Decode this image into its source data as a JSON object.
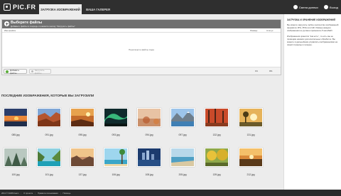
{
  "header": {
    "logo_text": "PIC.FR",
    "tabs": [
      {
        "label": "ЗАГРУЗКА ИЗОБРАЖЕНИЙ",
        "active": true
      },
      {
        "label": "ВАША ГАЛЕРЕЯ",
        "active": false
      }
    ],
    "right_links": [
      {
        "label": "Смена данных",
        "icon": "settings-icon"
      },
      {
        "label": "Выход",
        "icon": "logout-icon"
      }
    ]
  },
  "uploader": {
    "title": "Выберите файлы",
    "subtitle": "Добавьте файлы в очередь и нажмите кнопку \"Загрузить файлы\"",
    "columns": {
      "name": "Имя файла",
      "size": "Размер",
      "status": "Статус"
    },
    "drop_hint": "Перетащите файлы сюда",
    "add_button": "Добавить файлы",
    "start_button": "Загрузить файлы",
    "total_size": "0 b",
    "total_percent": "0%"
  },
  "sidebar": {
    "title": "ЗАГРУЗКА И ХРАНЕНИЕ ИЗОБРАЖЕНИЙ",
    "paragraphs": [
      "Вы можете загрузить любое количество изображений форматов JPG, PNG или GIF. Размер каждого изображения не должен превышать 5 мегабайт.",
      "Изображения хранятся \"как есть\", то есть мы не проводим никаких дополнительных обработок. Вы можете в дальнейшем управлять изображениями на своей странице в галерее."
    ]
  },
  "gallery": {
    "section_title": "ПОСЛЕДНИЕ ИЗОБРАЖЕНИЯ, КОТОРЫЕ ВЫ ЗАГРУЗИЛИ",
    "images": [
      {
        "caption": "085.jpg",
        "scene": "sunset-sea"
      },
      {
        "caption": "091.jpg",
        "scene": "canyon"
      },
      {
        "caption": "095.jpg",
        "scene": "desert-sunset"
      },
      {
        "caption": "093.jpg",
        "scene": "aurora"
      },
      {
        "caption": "094.jpg",
        "scene": "autumn-haze"
      },
      {
        "caption": "097.jpg",
        "scene": "lake-mountains"
      },
      {
        "caption": "132.jpg",
        "scene": "red-forest"
      },
      {
        "caption": "131.jpg",
        "scene": "sunrise-tree"
      },
      {
        "caption": "100.jpg",
        "scene": "misty-forest"
      },
      {
        "caption": "101.jpg",
        "scene": "tropical-bay"
      },
      {
        "caption": "137.jpg",
        "scene": "rocky-sunset"
      },
      {
        "caption": "106.jpg",
        "scene": "beach-palm"
      },
      {
        "caption": "108.jpg",
        "scene": "city-lake"
      },
      {
        "caption": "205.jpg",
        "scene": "sea-shore"
      },
      {
        "caption": "139.jpg",
        "scene": "yellow-trees"
      },
      {
        "caption": "212.jpg",
        "scene": "field-sunset"
      }
    ]
  },
  "footer": {
    "copyright": "2011 © FARM team",
    "links": [
      "О проекте",
      "Правила пользования",
      "Помощь"
    ]
  }
}
